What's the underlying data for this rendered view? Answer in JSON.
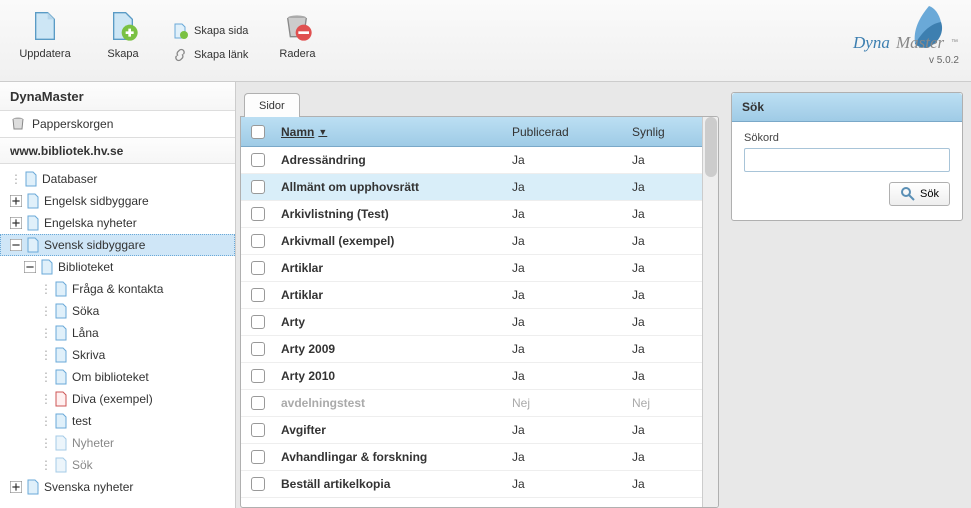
{
  "app": {
    "name": "DynaMaster",
    "version": "v 5.0.2"
  },
  "toolbar": {
    "update": "Uppdatera",
    "create": "Skapa",
    "create_page": "Skapa sida",
    "create_link": "Skapa länk",
    "delete": "Radera"
  },
  "sidebar": {
    "section1_title": "DynaMaster",
    "trash": "Papperskorgen",
    "section2_title": "www.bibliotek.hv.se",
    "tree": {
      "databases": "Databaser",
      "eng_builder": "Engelsk sidbyggare",
      "eng_news": "Engelska nyheter",
      "sv_builder": "Svensk sidbyggare",
      "library": "Biblioteket",
      "children": {
        "ask": "Fråga & kontakta",
        "search": "Söka",
        "loan": "Låna",
        "write": "Skriva",
        "about": "Om biblioteket",
        "diva": "Diva (exempel)",
        "test": "test",
        "news": "Nyheter",
        "sok": "Sök"
      },
      "sv_news": "Svenska nyheter"
    }
  },
  "tabs": {
    "pages": "Sidor"
  },
  "table": {
    "columns": {
      "name": "Namn",
      "published": "Publicerad",
      "visible": "Synlig"
    },
    "rows": [
      {
        "name": "Adressändring",
        "pub": "Ja",
        "vis": "Ja",
        "highlight": false,
        "dim": false
      },
      {
        "name": "Allmänt om upphovsrätt",
        "pub": "Ja",
        "vis": "Ja",
        "highlight": true,
        "dim": false
      },
      {
        "name": "Arkivlistning (Test)",
        "pub": "Ja",
        "vis": "Ja",
        "highlight": false,
        "dim": false
      },
      {
        "name": "Arkivmall (exempel)",
        "pub": "Ja",
        "vis": "Ja",
        "highlight": false,
        "dim": false
      },
      {
        "name": "Artiklar",
        "pub": "Ja",
        "vis": "Ja",
        "highlight": false,
        "dim": false
      },
      {
        "name": "Artiklar",
        "pub": "Ja",
        "vis": "Ja",
        "highlight": false,
        "dim": false
      },
      {
        "name": "Arty",
        "pub": "Ja",
        "vis": "Ja",
        "highlight": false,
        "dim": false
      },
      {
        "name": "Arty 2009",
        "pub": "Ja",
        "vis": "Ja",
        "highlight": false,
        "dim": false
      },
      {
        "name": "Arty 2010",
        "pub": "Ja",
        "vis": "Ja",
        "highlight": false,
        "dim": false
      },
      {
        "name": "avdelningstest",
        "pub": "Nej",
        "vis": "Nej",
        "highlight": false,
        "dim": true
      },
      {
        "name": "Avgifter",
        "pub": "Ja",
        "vis": "Ja",
        "highlight": false,
        "dim": false
      },
      {
        "name": "Avhandlingar & forskning",
        "pub": "Ja",
        "vis": "Ja",
        "highlight": false,
        "dim": false
      },
      {
        "name": "Beställ artikelkopia",
        "pub": "Ja",
        "vis": "Ja",
        "highlight": false,
        "dim": false
      }
    ]
  },
  "search": {
    "title": "Sök",
    "label": "Sökord",
    "button": "Sök"
  }
}
